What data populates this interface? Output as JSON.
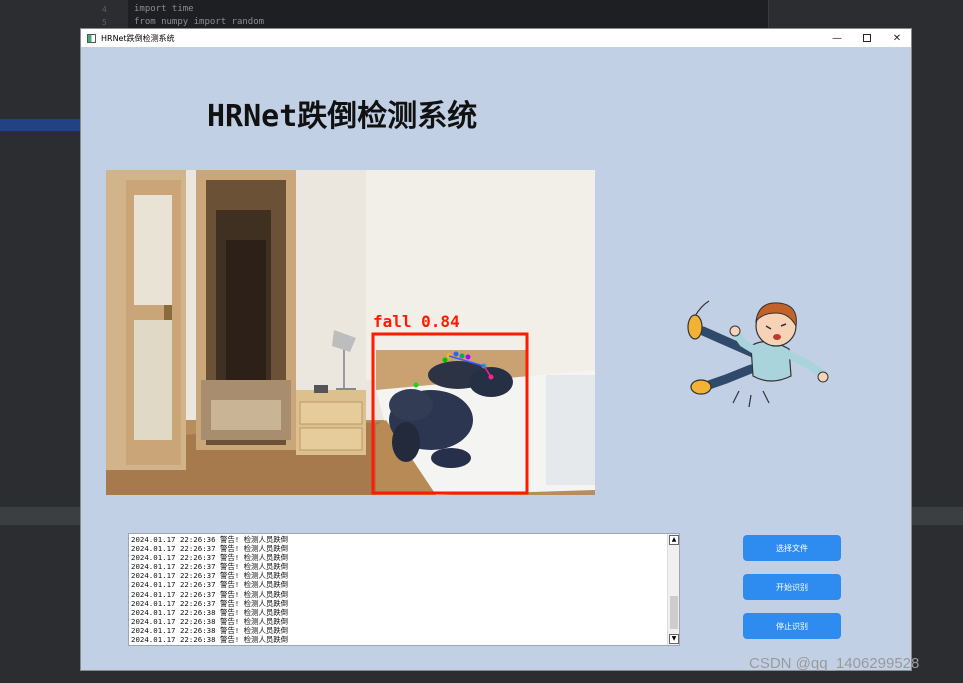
{
  "ide": {
    "lines": [
      {
        "num": "4",
        "code": "import time"
      },
      {
        "num": "5",
        "code": "from numpy import random"
      }
    ]
  },
  "window": {
    "title": "HRNet跌倒检测系统",
    "minimize_icon": "minimize-icon",
    "maximize_icon": "maximize-icon",
    "close_icon": "close-icon"
  },
  "header": {
    "title": "HRNet跌倒检测系统"
  },
  "video": {
    "detection_label": "fall 0.84",
    "box_color": "#ff1a00"
  },
  "log": {
    "lines": [
      "2024.01.17 22:26:36 警告! 检测人员跌倒",
      "2024.01.17 22:26:37 警告! 检测人员跌倒",
      "2024.01.17 22:26:37 警告! 检测人员跌倒",
      "2024.01.17 22:26:37 警告! 检测人员跌倒",
      "2024.01.17 22:26:37 警告! 检测人员跌倒",
      "2024.01.17 22:26:37 警告! 检测人员跌倒",
      "2024.01.17 22:26:37 警告! 检测人员跌倒",
      "2024.01.17 22:26:37 警告! 检测人员跌倒",
      "2024.01.17 22:26:38 警告! 检测人员跌倒",
      "2024.01.17 22:26:38 警告! 检测人员跌倒",
      "2024.01.17 22:26:38 警告! 检测人员跌倒",
      "2024.01.17 22:26:38 警告! 检测人员跌倒"
    ]
  },
  "buttons": {
    "select_file": "选择文件",
    "start": "开始识别",
    "stop": "停止识别"
  },
  "colors": {
    "window_bg": "#c2d0e6",
    "button_bg": "#2e8cf0"
  },
  "watermark": "CSDN @qq_1406299528"
}
